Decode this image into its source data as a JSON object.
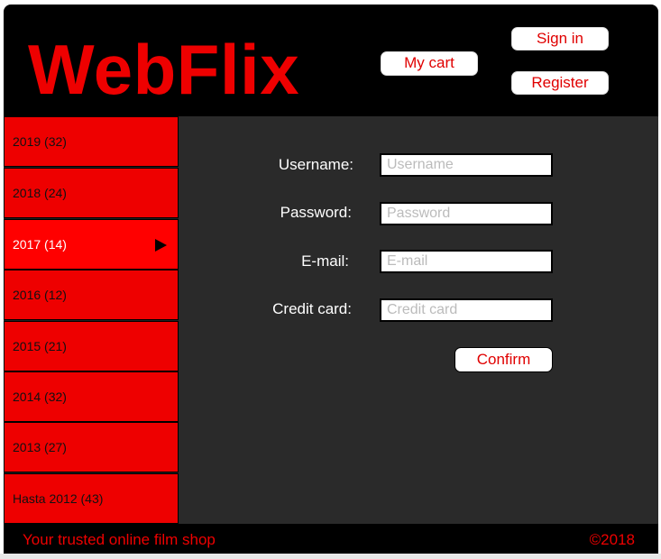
{
  "header": {
    "logo": "WebFlix",
    "cart_label": "My cart",
    "signin_label": "Sign in",
    "register_label": "Register"
  },
  "sidebar": {
    "items": [
      {
        "label": "2019 (32)",
        "active": false
      },
      {
        "label": "2018 (24)",
        "active": false
      },
      {
        "label": "2017 (14)",
        "active": true
      },
      {
        "label": "2016 (12)",
        "active": false
      },
      {
        "label": "2015 (21)",
        "active": false
      },
      {
        "label": "2014 (32)",
        "active": false
      },
      {
        "label": "2013 (27)",
        "active": false
      },
      {
        "label": "Hasta 2012 (43)",
        "active": false
      }
    ]
  },
  "form": {
    "username_label": "Username:",
    "username_placeholder": "Username",
    "password_label": "Password:",
    "password_placeholder": "Password",
    "email_label": "E-mail:",
    "email_placeholder": "E-mail",
    "card_label": "Credit card:",
    "card_placeholder": "Credit card",
    "confirm_label": "Confirm"
  },
  "footer": {
    "tagline": "Your trusted online film shop",
    "copyright": "©2018"
  },
  "colors": {
    "brand_red": "#ee0000",
    "active_red": "#ff0000",
    "panel_bg": "#2a2a2a",
    "header_bg": "#000000"
  }
}
